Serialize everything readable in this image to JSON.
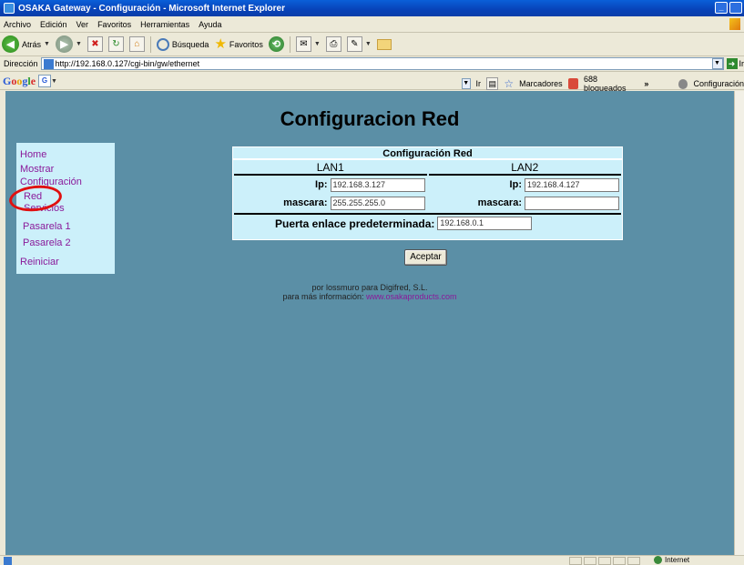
{
  "window": {
    "title": "OSAKA Gateway - Configuración - Microsoft Internet Explorer",
    "min": "_",
    "max": " ",
    "close": "×"
  },
  "menu": [
    "Archivo",
    "Edición",
    "Ver",
    "Favoritos",
    "Herramientas",
    "Ayuda"
  ],
  "toolbar": {
    "back": "Atrás",
    "search": "Búsqueda",
    "favorites": "Favoritos"
  },
  "address": {
    "label": "Dirección",
    "url": "http://192.168.0.127/cgi-bin/gw/ethernet",
    "go": "Ir"
  },
  "googlebar": {
    "g_button": "G",
    "go": "Ir",
    "bookmarks": "Marcadores",
    "blocked": "688 bloqueados",
    "more": "»",
    "settings": "Configuración"
  },
  "page": {
    "title": "Configuracion Red"
  },
  "nav": {
    "home": "Home",
    "mostrar": "Mostrar",
    "configuracion": "Configuración",
    "red": "Red",
    "servicios": "Servicios",
    "pasarela1": "Pasarela 1",
    "pasarela2": "Pasarela 2",
    "reiniciar": "Reiniciar"
  },
  "form": {
    "header": "Configuración Red",
    "lan1": {
      "title": "LAN1",
      "ip_label": "Ip:",
      "ip_value": "192.168.3.127",
      "mask_label": "mascara:",
      "mask_value": "255.255.255.0"
    },
    "lan2": {
      "title": "LAN2",
      "ip_label": "Ip:",
      "ip_value": "192.168.4.127",
      "mask_label": "mascara:",
      "mask_value": ""
    },
    "gateway_label": "Puerta enlace predeterminada:",
    "gateway_value": "192.168.0.1",
    "accept": "Aceptar"
  },
  "footer": {
    "line1": "por lossmuro para Digifred, S.L.",
    "line2_prefix": "para más información:",
    "link": "www.osakaproducts.com"
  },
  "status": {
    "zone": "Internet"
  },
  "annotation": {
    "color": "#e01010"
  }
}
